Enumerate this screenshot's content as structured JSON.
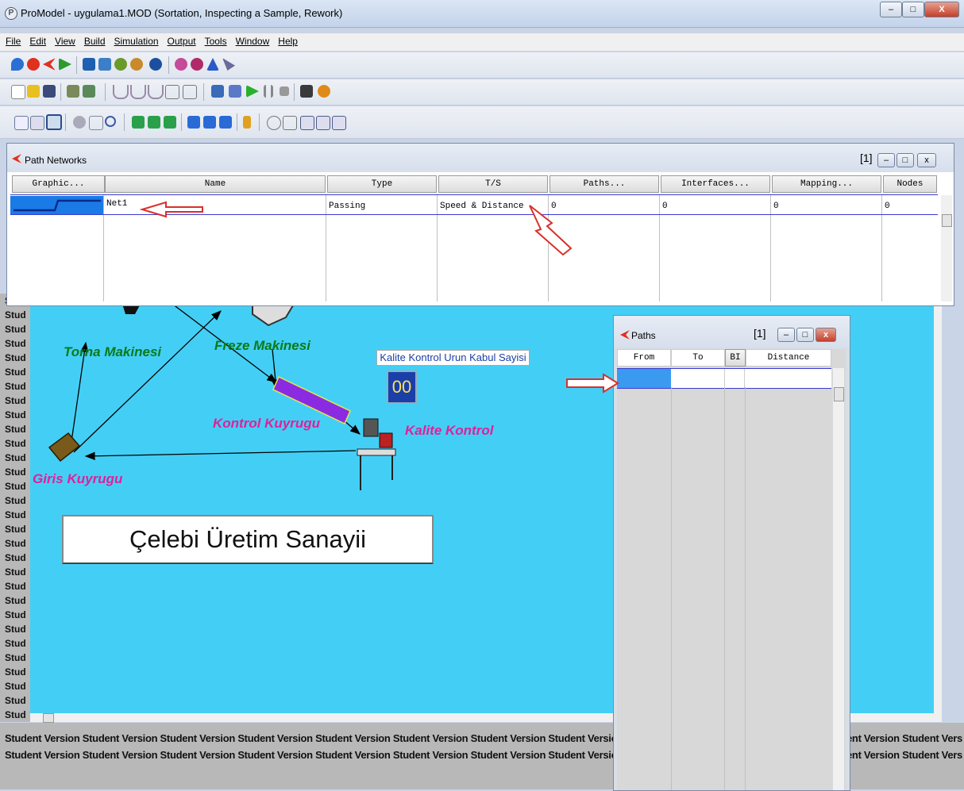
{
  "window": {
    "title": "ProModel - uygulama1.MOD (Sortation, Inspecting a Sample, Rework)",
    "minimize": "–",
    "maximize": "□",
    "close": "X"
  },
  "menu": [
    "File",
    "Edit",
    "View",
    "Build",
    "Simulation",
    "Output",
    "Tools",
    "Window",
    "Help"
  ],
  "path_networks": {
    "title": "Path Networks",
    "window_index": "[1]",
    "columns": [
      "Graphic...",
      "Name",
      "Type",
      "T/S",
      "Paths...",
      "Interfaces...",
      "Mapping...",
      "Nodes"
    ],
    "row": {
      "name": "Net1",
      "type": "Passing",
      "ts": "Speed & Distance",
      "paths": "0",
      "interfaces": "0",
      "mapping": "0",
      "nodes": "0"
    }
  },
  "paths_window": {
    "title": "Paths",
    "window_index": "[1]",
    "columns": [
      "From",
      "To",
      "BI",
      "Distance"
    ]
  },
  "layout_labels": {
    "torna": "Torna Makinesi",
    "freze": "Freze Makinesi",
    "kontrol_kuyrugu": "Kontrol Kuyrugu",
    "kalite_kontrol": "Kalite Kontrol",
    "giris_kuyrugu": "Giris Kuyrugu",
    "counter_title": "Kalite Kontrol Urun Kabul Sayisi",
    "counter_value": "00",
    "banner": "Çelebi Üretim Sanayii"
  },
  "watermark": {
    "left_fragment": "Stud",
    "line": "Student Version Student Version Student Version Student Version Student Version Student Version Student Version Student Version St",
    "right_fragment": "ent Version Student Vers"
  },
  "colors": {
    "canvas": "#43cff5",
    "kontrol_kuyrugu_bar": "#8a2be2",
    "counter_bg": "#1a3fa8",
    "annotation_arrow": "#d9302a"
  }
}
